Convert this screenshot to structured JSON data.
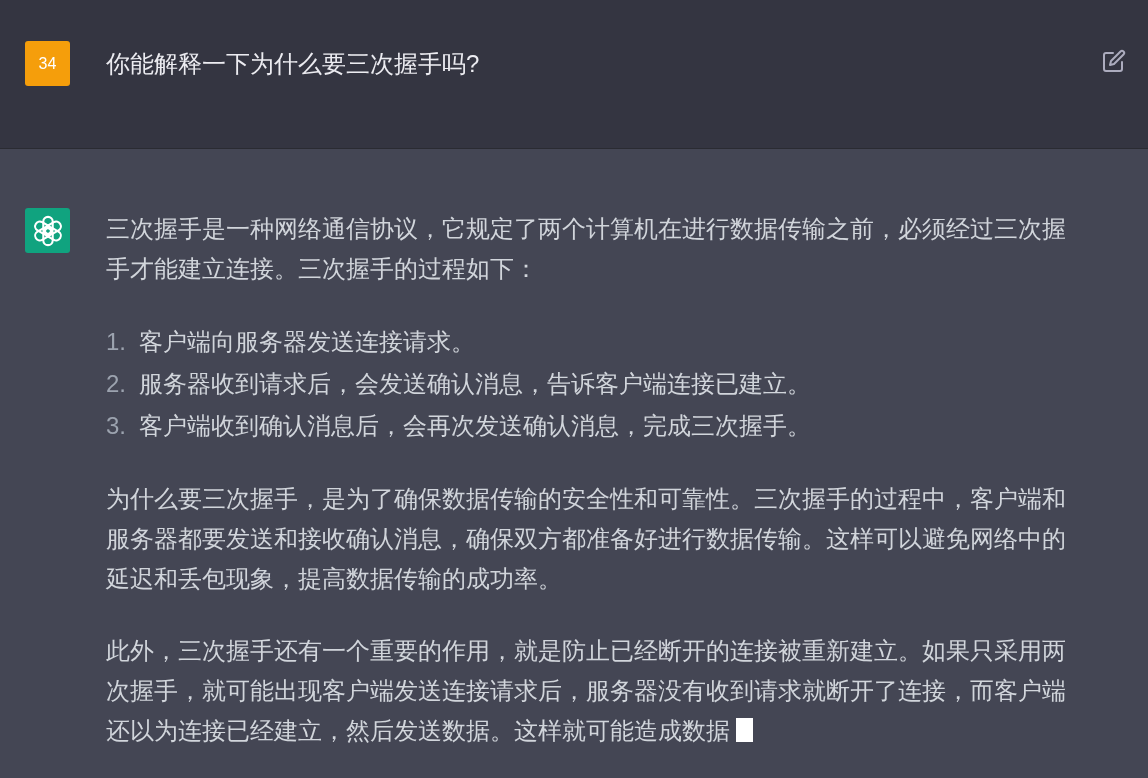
{
  "question": {
    "avatar": "34",
    "text": "你能解释一下为什么要三次握手吗?"
  },
  "answer": {
    "blocks": [
      {
        "kind": "paragraph",
        "text": "三次握手是一种网络通信协议，它规定了两个计算机在进行数据传输之前，必须经过三次握手才能建立连接。三次握手的过程如下："
      },
      {
        "kind": "list",
        "items": [
          {
            "number": "1.",
            "text": "客户端向服务器发送连接请求。"
          },
          {
            "number": "2.",
            "text": "服务器收到请求后，会发送确认消息，告诉客户端连接已建立。"
          },
          {
            "number": "3.",
            "text": "客户端收到确认消息后，会再次发送确认消息，完成三次握手。"
          }
        ]
      },
      {
        "kind": "paragraph",
        "text": "为什么要三次握手，是为了确保数据传输的安全性和可靠性。三次握手的过程中，客户端和服务器都要发送和接收确认消息，确保双方都准备好进行数据传输。这样可以避免网络中的延迟和丢包现象，提高数据传输的成功率。"
      },
      {
        "kind": "paragraph",
        "text": "此外，三次握手还有一个重要的作用，就是防止已经断开的连接被重新建立。如果只采用两次握手，就可能出现客户端发送连接请求后，服务器没有收到请求就断开了连接，而客户端还以为连接已经建立，然后发送数据。这样就可能造成数据"
      }
    ],
    "cursor": true
  }
}
